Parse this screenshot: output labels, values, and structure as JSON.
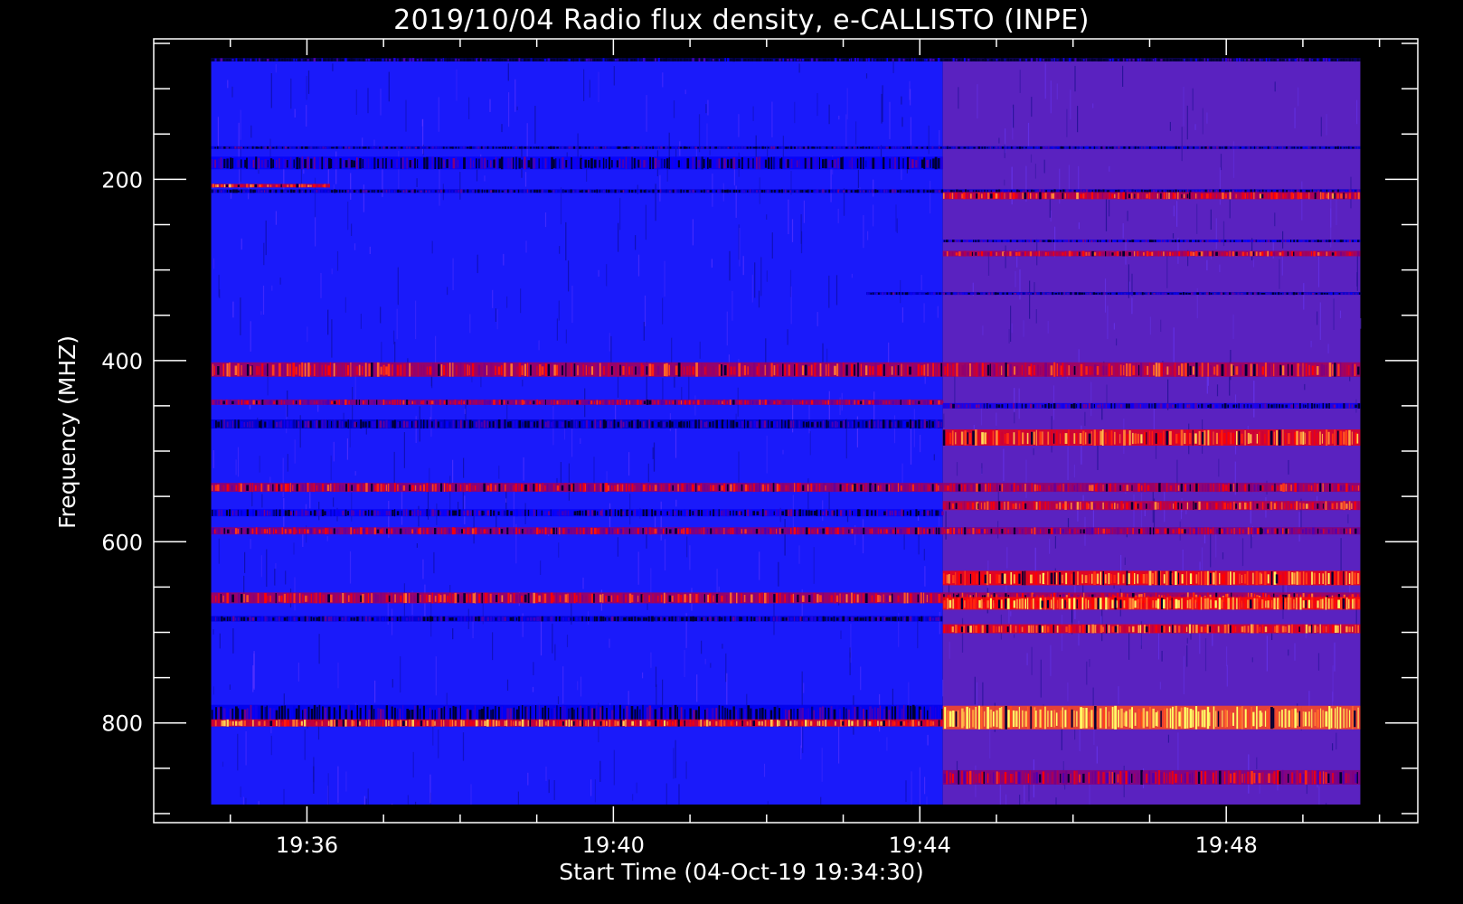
{
  "chart_data": {
    "type": "heatmap",
    "title": "2019/10/04  Radio flux density, e-CALLISTO (INPE)",
    "xlabel": "Start Time (04-Oct-19 19:34:30)",
    "ylabel": "Frequency (MHZ)",
    "x_axis": {
      "unit": "minutes after 19:34:30",
      "range": [
        -0.5,
        16.0
      ],
      "major_ticks": [
        {
          "value": 1.5,
          "label": "19:36"
        },
        {
          "value": 5.5,
          "label": "19:40"
        },
        {
          "value": 9.5,
          "label": "19:44"
        },
        {
          "value": 13.5,
          "label": "19:48"
        }
      ],
      "minor_step": 1.0
    },
    "y_axis": {
      "range": [
        45,
        910
      ],
      "inverted": true,
      "major_ticks": [
        200,
        400,
        600,
        800
      ],
      "minor_step": 50
    },
    "data_extent": {
      "time_range": [
        0.25,
        15.25
      ],
      "freq_range": [
        66,
        890
      ]
    },
    "colormap": {
      "low": "#0000ff",
      "mid": "#ff0000",
      "high": "#ffff66",
      "dark": "#000033"
    },
    "background_step": {
      "time": 9.8,
      "before": "#1a1afa",
      "after": "#5a22c0"
    },
    "frequency_bands": [
      {
        "freq": 68,
        "width": 4,
        "level": 0.0,
        "extent": [
          0.25,
          15.25
        ]
      },
      {
        "freq": 165,
        "width": 3,
        "level": 0.05,
        "extent": [
          0.25,
          15.25
        ]
      },
      {
        "freq": 182,
        "width": 14,
        "level": 0.08,
        "extent": [
          0.25,
          9.8
        ]
      },
      {
        "freq": 207,
        "width": 4,
        "level": 0.65,
        "extent": [
          0.25,
          1.8
        ]
      },
      {
        "freq": 213,
        "width": 4,
        "level": 0.05,
        "extent": [
          0.25,
          15.25
        ]
      },
      {
        "freq": 218,
        "width": 8,
        "level": 0.6,
        "extent": [
          9.8,
          15.25
        ]
      },
      {
        "freq": 268,
        "width": 3,
        "level": 0.1,
        "extent": [
          9.8,
          15.25
        ]
      },
      {
        "freq": 282,
        "width": 6,
        "level": 0.55,
        "extent": [
          9.8,
          15.25
        ]
      },
      {
        "freq": 326,
        "width": 3,
        "level": 0.05,
        "extent": [
          8.8,
          15.25
        ]
      },
      {
        "freq": 410,
        "width": 16,
        "level": 0.55,
        "extent": [
          0.25,
          15.25
        ]
      },
      {
        "freq": 446,
        "width": 6,
        "level": 0.45,
        "extent": [
          0.25,
          9.8
        ]
      },
      {
        "freq": 450,
        "width": 6,
        "level": 0.1,
        "extent": [
          9.8,
          15.25
        ]
      },
      {
        "freq": 470,
        "width": 10,
        "level": 0.05,
        "extent": [
          0.25,
          9.8
        ]
      },
      {
        "freq": 485,
        "width": 18,
        "level": 0.72,
        "extent": [
          9.8,
          15.25
        ]
      },
      {
        "freq": 540,
        "width": 10,
        "level": 0.5,
        "extent": [
          0.25,
          15.25
        ]
      },
      {
        "freq": 560,
        "width": 10,
        "level": 0.6,
        "extent": [
          9.8,
          15.25
        ]
      },
      {
        "freq": 568,
        "width": 8,
        "level": 0.08,
        "extent": [
          0.25,
          9.8
        ]
      },
      {
        "freq": 588,
        "width": 8,
        "level": 0.45,
        "extent": [
          0.25,
          15.25
        ]
      },
      {
        "freq": 640,
        "width": 16,
        "level": 0.78,
        "extent": [
          9.8,
          15.25
        ]
      },
      {
        "freq": 662,
        "width": 12,
        "level": 0.55,
        "extent": [
          0.25,
          15.25
        ]
      },
      {
        "freq": 668,
        "width": 14,
        "level": 0.82,
        "extent": [
          9.8,
          15.25
        ]
      },
      {
        "freq": 685,
        "width": 6,
        "level": 0.05,
        "extent": [
          0.25,
          9.8
        ]
      },
      {
        "freq": 696,
        "width": 10,
        "level": 0.7,
        "extent": [
          9.8,
          15.25
        ]
      },
      {
        "freq": 790,
        "width": 20,
        "level": 0.06,
        "extent": [
          0.25,
          9.8
        ]
      },
      {
        "freq": 800,
        "width": 8,
        "level": 0.7,
        "extent": [
          0.25,
          9.8
        ]
      },
      {
        "freq": 794,
        "width": 26,
        "level": 0.95,
        "extent": [
          9.8,
          15.25
        ]
      },
      {
        "freq": 860,
        "width": 16,
        "level": 0.45,
        "extent": [
          9.8,
          15.25
        ]
      }
    ]
  }
}
